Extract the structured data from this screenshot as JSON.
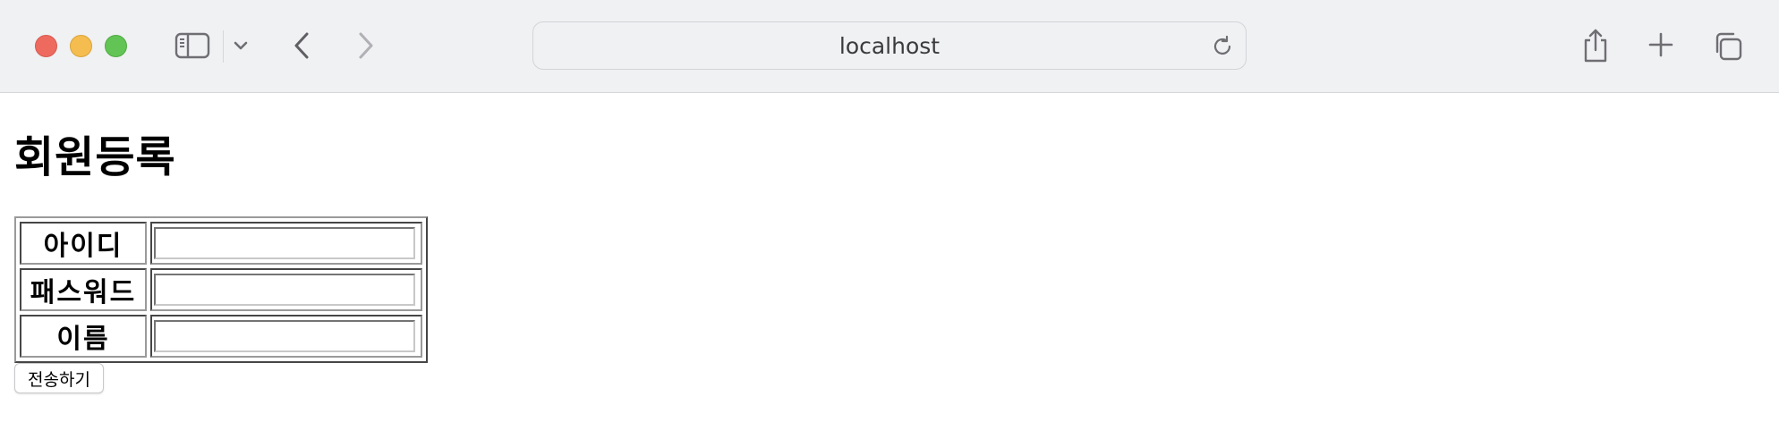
{
  "browser": {
    "url": "localhost",
    "icons": {
      "close": "close-button",
      "minimize": "minimize-button",
      "maximize": "maximize-button",
      "sidebar": "sidebar-icon",
      "sidebar_menu": "chevron-down-icon",
      "back": "chevron-left-icon",
      "forward": "chevron-right-icon",
      "reload": "reload-icon",
      "share": "share-icon",
      "new_tab": "plus-icon",
      "tab_overview": "tabs-icon"
    },
    "colors": {
      "close": "#ee6a5f",
      "minimize": "#f5bd4f",
      "maximize": "#61c454",
      "toolbar_bg": "#f0f1f3"
    }
  },
  "page": {
    "title": "회원등록",
    "form": {
      "fields": [
        {
          "label": "아이디",
          "value": ""
        },
        {
          "label": "패스워드",
          "value": ""
        },
        {
          "label": "이름",
          "value": ""
        }
      ],
      "submit_label": "전송하기"
    }
  }
}
